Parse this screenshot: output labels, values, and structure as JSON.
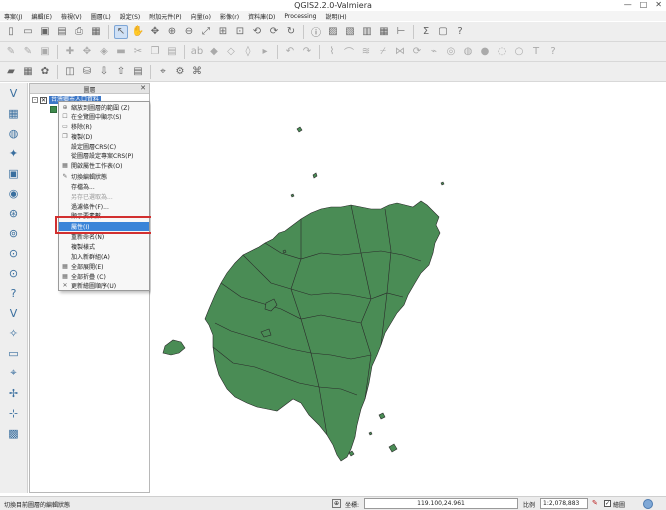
{
  "window": {
    "title": "QGIS2.2.0-Valmiera",
    "minimize": "—",
    "maximize": "□",
    "close": "✕"
  },
  "menubar": {
    "items": [
      "專案(J)",
      "編輯(E)",
      "檢視(V)",
      "圖層(L)",
      "設定(S)",
      "附加元件(P)",
      "向量(o)",
      "影像(r)",
      "資料庫(D)",
      "Processing",
      "說明(H)"
    ]
  },
  "layer_panel": {
    "title": "圖層",
    "close_glyph": "✕",
    "expander_glyph": "-",
    "check_glyph": "✕",
    "layer_name": "台灣鄉市人口資料"
  },
  "context_menu": {
    "items": [
      {
        "label": "縮放到圖層的範圍 (Z)",
        "icon": "zoom-layer-icon",
        "state": "normal"
      },
      {
        "label": "在全覽圖中顯示(S)",
        "icon": "overview-checkbox-icon",
        "state": "normal"
      },
      {
        "label": "移除(R)",
        "icon": "remove-icon",
        "state": "normal"
      },
      {
        "label": "複製(D)",
        "icon": "duplicate-icon",
        "state": "normal"
      },
      {
        "label": "設定圖層CRS(C)",
        "icon": "",
        "state": "normal"
      },
      {
        "label": "從圖層設定專案CRS(P)",
        "icon": "",
        "state": "normal"
      },
      {
        "label": "開啟屬性工作表(O)",
        "icon": "attribute-table-icon",
        "state": "normal"
      },
      {
        "label": "切換編輯狀態",
        "icon": "pencil-icon",
        "state": "normal"
      },
      {
        "label": "存檔為...",
        "icon": "",
        "state": "normal"
      },
      {
        "label": "另存已選取為...",
        "icon": "",
        "state": "disabled"
      },
      {
        "label": "過濾條件(F)...",
        "icon": "",
        "state": "normal"
      },
      {
        "label": "顯示要素數",
        "icon": "",
        "state": "normal"
      },
      {
        "label": "屬性(I)",
        "icon": "",
        "state": "highlight"
      },
      {
        "label": "重新命名(N)",
        "icon": "",
        "state": "normal"
      },
      {
        "label": "複製樣式",
        "icon": "",
        "state": "normal"
      },
      {
        "label": "加入新群組(A)",
        "icon": "",
        "state": "normal"
      },
      {
        "label": "全部展開(E)",
        "icon": "expand-all-icon",
        "state": "normal"
      },
      {
        "label": "全部折疊 (C)",
        "icon": "collapse-all-icon",
        "state": "normal"
      },
      {
        "label": "更新繪圖順序(U)",
        "icon": "close-icon",
        "state": "normal"
      }
    ]
  },
  "statusbar": {
    "message": "切換目前圖層的編輯狀態",
    "coord_label": "坐標:",
    "coordinate": "119.100,24.961",
    "scale_label": "比例",
    "scale": "1:2,078,883",
    "render_check": "✓",
    "render_label": "繪圖"
  },
  "colors": {
    "map_fill": "#4a8c55",
    "map_stroke": "#2a2a2a",
    "highlight": "#3a84d8",
    "annotation_box": "#d22f2f",
    "layer_selection": "#3d78c8"
  },
  "icons": {
    "toolbar1": [
      "new-project-icon",
      "open-project-icon",
      "save-project-icon",
      "save-as-icon",
      "print-composer-icon",
      "composer-manager-icon",
      "select-icon",
      "pan-icon",
      "pan-to-selection-icon",
      "zoom-in-icon",
      "zoom-out-icon",
      "zoom-full-icon",
      "zoom-layer-icon",
      "zoom-selection-icon",
      "zoom-last-icon",
      "zoom-next-icon",
      "refresh-icon",
      "identify-icon",
      "select-features-icon",
      "deselect-icon",
      "field-calculator-icon",
      "attribute-table-icon",
      "measure-icon",
      "stats-icon",
      "tips-icon",
      "help-icon"
    ],
    "toolbar2": [
      "toggle-edit-icon",
      "pencil-icon",
      "save-edits-icon",
      "add-feature-icon",
      "move-feature-icon",
      "node-tool-icon",
      "delete-selected-icon",
      "cut-icon",
      "copy-icon",
      "paste-icon",
      "label-icon",
      "label-pin-icon",
      "label-rotate-icon",
      "label-change-icon",
      "label-move-icon",
      "undo-icon",
      "redo-icon",
      "digitize-icon",
      "reshape-icon",
      "offset-icon",
      "split-icon",
      "merge-icon",
      "rotate-icon",
      "simplify-icon",
      "add-ring-icon",
      "add-part-icon",
      "fill-ring-icon",
      "delete-ring-icon",
      "delete-part-icon",
      "text-annotation-icon",
      "whats-this-icon"
    ],
    "toolbar3": [
      "vector-tool-icon",
      "raster-tool-icon",
      "grass-icon",
      "spit-icon",
      "db-icon",
      "import-icon",
      "export-icon",
      "delimited-icon",
      "gps-icon",
      "plugin-icon",
      "python-icon"
    ],
    "left": [
      "add-vector-icon",
      "add-raster-icon",
      "add-postgis-icon",
      "add-spatialite-icon",
      "add-mssql-icon",
      "add-oracle-icon",
      "add-wms-icon",
      "add-wcs-icon",
      "add-wfs-icon",
      "add-wfs-icon",
      "add-delimited-icon",
      "new-layer-icon",
      "new-spatialite-icon",
      "remove-layer-icon",
      "gps-track-icon",
      "coordinate-capture-icon",
      "georeferencer-icon",
      "heatmap-icon"
    ]
  }
}
